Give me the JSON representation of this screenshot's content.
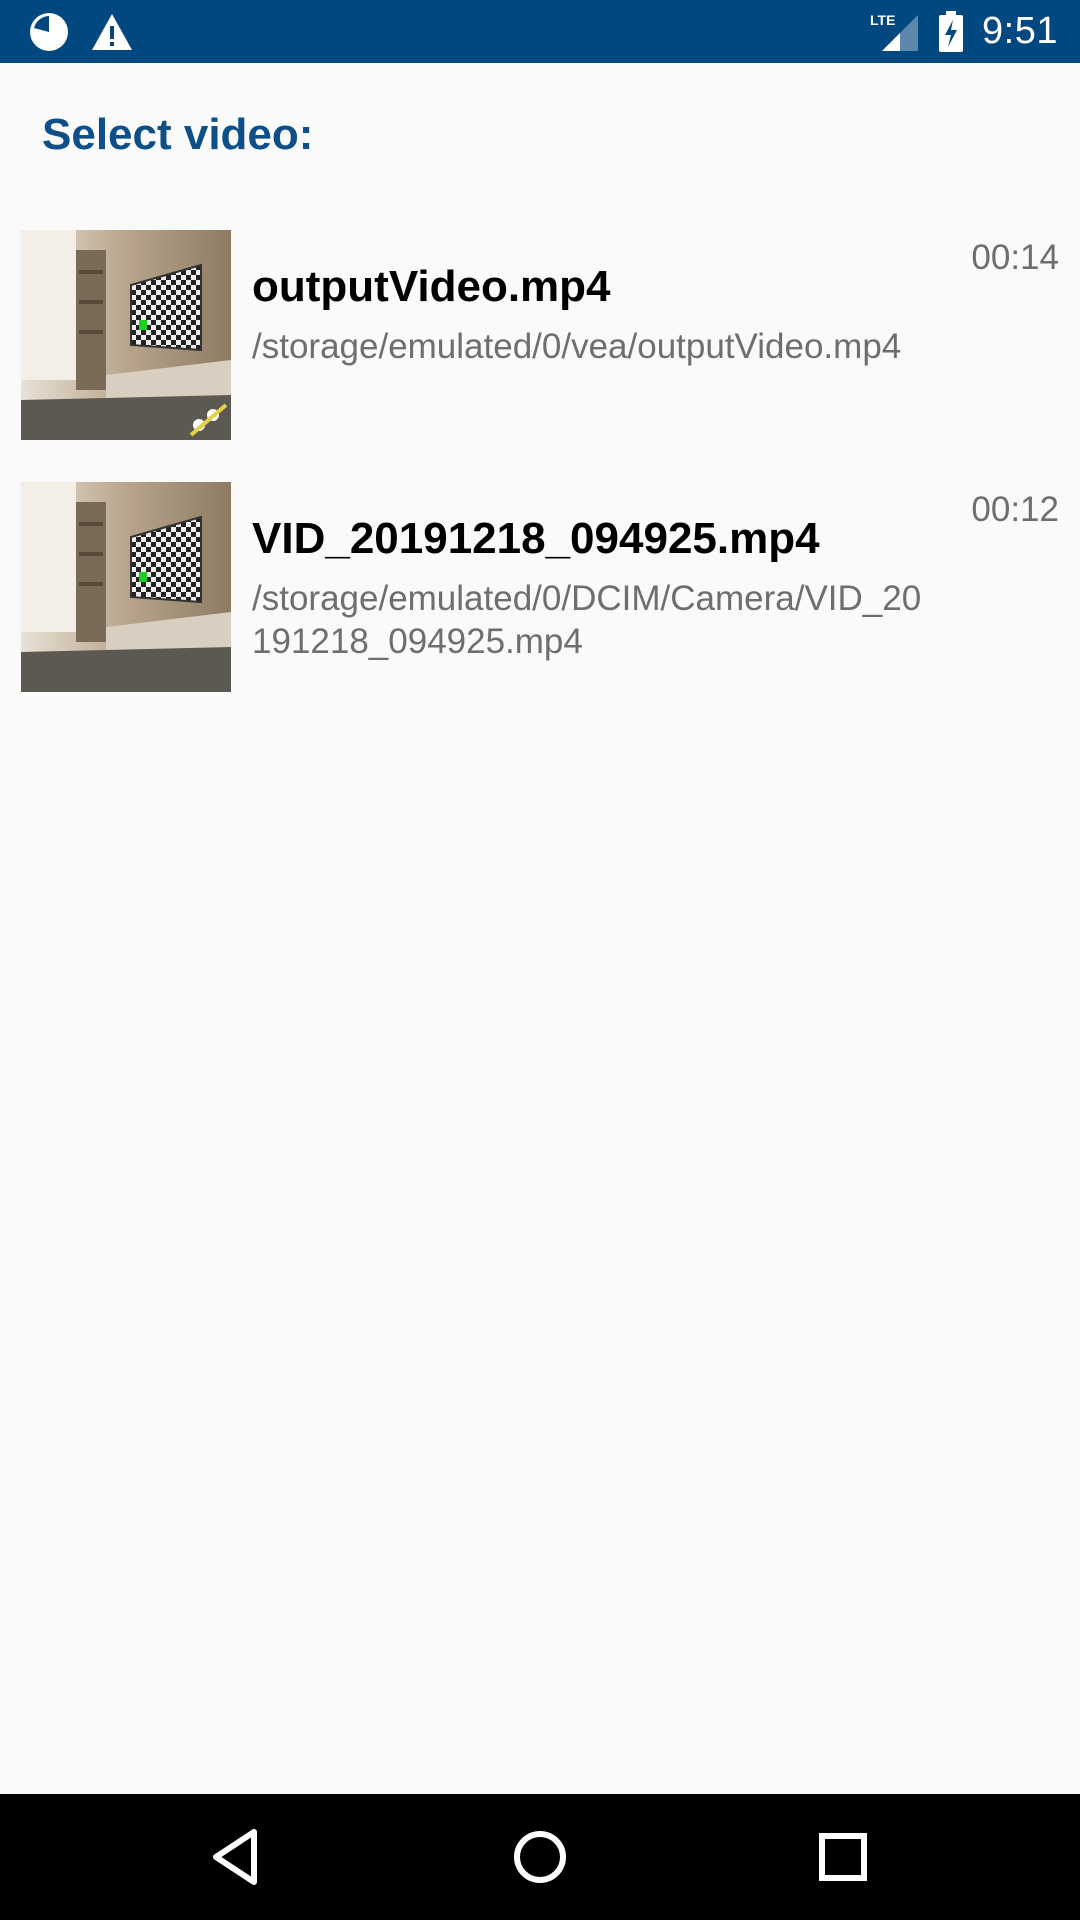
{
  "status_bar": {
    "time": "9:51",
    "network": "LTE",
    "icons": [
      "app-status-icon",
      "warning-icon",
      "lte-signal-icon",
      "battery-charging-icon"
    ],
    "background_color": "#014880"
  },
  "header": {
    "title": "Select video:"
  },
  "videos": [
    {
      "name": "outputVideo.mp4",
      "path": "/storage/emulated/0/vea/outputVideo.mp4",
      "duration": "00:14"
    },
    {
      "name": "VID_20191218_094925.mp4",
      "path": "/storage/emulated/0/DCIM/Camera/VID_20191218_094925.mp4",
      "duration": "00:12"
    }
  ],
  "nav_bar": {
    "icons": [
      "back-icon",
      "home-icon",
      "recents-icon"
    ]
  },
  "colors": {
    "accent": "#0d4f86",
    "secondary_text": "#6e6e6e",
    "background": "#fafafa"
  }
}
